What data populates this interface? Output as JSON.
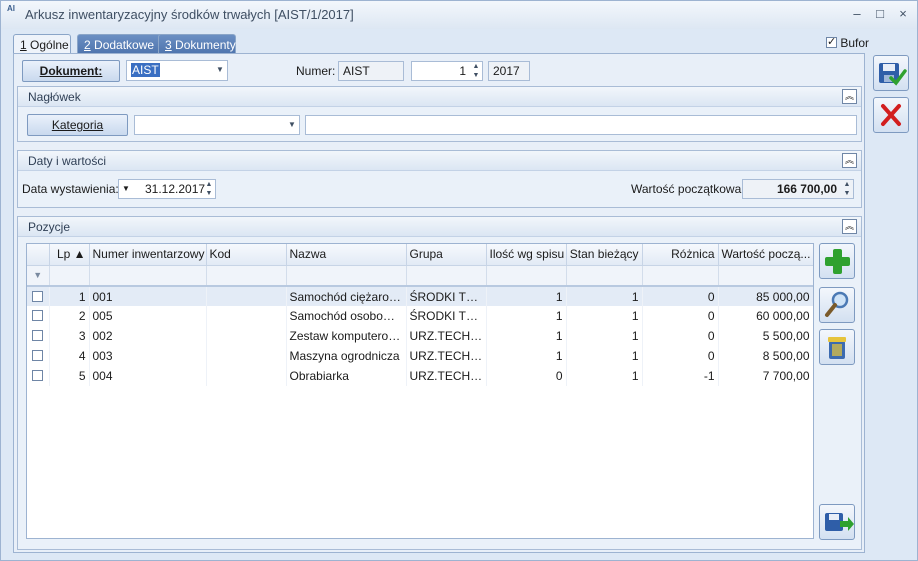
{
  "window": {
    "title": "Arkusz inwentaryzacyjny środków trwałych [AIST/1/2017]",
    "icon_text": "AI",
    "minimize": "–",
    "maximize": "□",
    "close": "×"
  },
  "tabs": [
    {
      "num": "1",
      "label": " Ogólne",
      "active": true
    },
    {
      "num": "2",
      "label": " Dodatkowe",
      "active": false
    },
    {
      "num": "3",
      "label": " Dokumenty",
      "active": false
    }
  ],
  "bufor": {
    "label": "Bufor",
    "checked": true
  },
  "document": {
    "button_label": "Dokument:",
    "type_value": "AIST",
    "numer_label": "Numer:",
    "numer_series": "AIST",
    "numer_value": "1",
    "numer_year": "2017"
  },
  "naglowek": {
    "title": "Nagłówek",
    "kategoria_button": "Kategoria",
    "kategoria_value": "",
    "kategoria_desc": ""
  },
  "daty": {
    "title": "Daty i wartości",
    "data_label": "Data wystawienia:",
    "data_value": "31.12.2017",
    "wartosc_label": "Wartość początkowa:",
    "wartosc_value": "166 700,00"
  },
  "pozycje": {
    "title": "Pozycje",
    "columns": [
      "",
      "Lp ▲",
      "Numer inwentarzowy",
      "Kod",
      "Nazwa",
      "Grupa",
      "Ilość wg spisu",
      "Stan bieżący",
      "Różnica",
      "Wartość począ..."
    ],
    "rows": [
      {
        "lp": "1",
        "numer": "001",
        "kod": "",
        "nazwa": "Samochód ciężarowy",
        "grupa": "ŚRODKI TR...",
        "ilosc": "1",
        "stan": "1",
        "roznica": "0",
        "wartosc": "85 000,00"
      },
      {
        "lp": "2",
        "numer": "005",
        "kod": "",
        "nazwa": "Samochód osobowy ...",
        "grupa": "ŚRODKI TR...",
        "ilosc": "1",
        "stan": "1",
        "roznica": "0",
        "wartosc": "60 000,00"
      },
      {
        "lp": "3",
        "numer": "002",
        "kod": "",
        "nazwa": "Zestaw komputerowy",
        "grupa": "URZ.TECH.I...",
        "ilosc": "1",
        "stan": "1",
        "roznica": "0",
        "wartosc": "5 500,00"
      },
      {
        "lp": "4",
        "numer": "003",
        "kod": "",
        "nazwa": "Maszyna ogrodnicza",
        "grupa": "URZ.TECH.I...",
        "ilosc": "1",
        "stan": "1",
        "roznica": "0",
        "wartosc": "8 500,00"
      },
      {
        "lp": "5",
        "numer": "004",
        "kod": "",
        "nazwa": "Obrabiarka",
        "grupa": "URZ.TECH.I...",
        "ilosc": "0",
        "stan": "1",
        "roznica": "-1",
        "wartosc": "7 700,00"
      }
    ]
  },
  "icons": {
    "save": "save-icon",
    "cancel": "close-icon",
    "add": "plus-icon",
    "preview": "magnifier-icon",
    "delete": "trash-icon",
    "import": "import-icon"
  },
  "colors": {
    "accent": "#4e74ad",
    "add_green": "#2fa12f",
    "cancel_red": "#d21e1e"
  }
}
